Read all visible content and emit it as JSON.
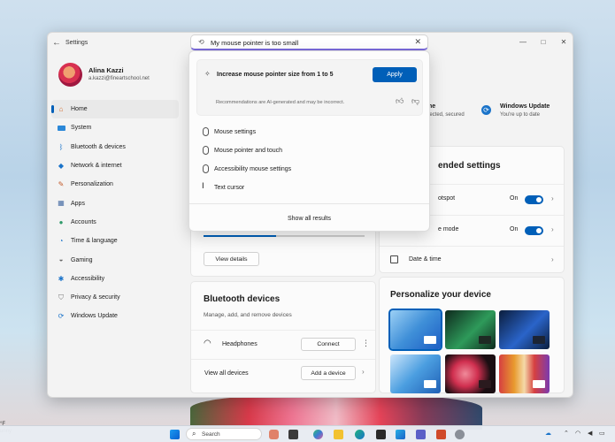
{
  "window": {
    "title": "Settings",
    "controls": [
      "—",
      "□",
      "✕"
    ]
  },
  "profile": {
    "name": "Alina Kazzi",
    "email": "a.kazzi@fineartschool.net"
  },
  "sidebar": {
    "items": [
      {
        "label": "Home",
        "icon": "home-icon",
        "active": true
      },
      {
        "label": "System",
        "icon": "system-icon"
      },
      {
        "label": "Bluetooth & devices",
        "icon": "bluetooth-icon"
      },
      {
        "label": "Network & internet",
        "icon": "wifi-icon"
      },
      {
        "label": "Personalization",
        "icon": "brush-icon"
      },
      {
        "label": "Apps",
        "icon": "apps-icon"
      },
      {
        "label": "Accounts",
        "icon": "accounts-icon"
      },
      {
        "label": "Time & language",
        "icon": "globe-clock-icon"
      },
      {
        "label": "Gaming",
        "icon": "gamepad-icon"
      },
      {
        "label": "Accessibility",
        "icon": "accessibility-icon"
      },
      {
        "label": "Privacy & security",
        "icon": "shield-icon"
      },
      {
        "label": "Windows Update",
        "icon": "update-icon"
      }
    ]
  },
  "search": {
    "value": "My mouse pointer is too small",
    "clear": "✕"
  },
  "popup": {
    "ai_suggestion": "Increase mouse pointer size from 1 to 5",
    "apply_label": "Apply",
    "ai_note": "Recommendations are AI-generated and may be incorrect.",
    "results": [
      {
        "label": "Mouse settings",
        "icon": "mouse-icon"
      },
      {
        "label": "Mouse pointer and touch",
        "icon": "mouse-icon"
      },
      {
        "label": "Accessibility mouse settings",
        "icon": "mouse-icon"
      },
      {
        "label": "Text cursor",
        "icon": "text-cursor-icon"
      }
    ],
    "show_all": "Show all results"
  },
  "status": {
    "partial_label_1": "me",
    "partial_sub_1": "nected, secured",
    "update_title": "Windows Update",
    "update_sub": "You're up to date"
  },
  "recommended": {
    "title_partial": "ended settings",
    "rows": [
      {
        "label_partial": "otspot",
        "state": "On",
        "toggle": true
      },
      {
        "label_partial": "e mode",
        "state": "On",
        "toggle": true
      },
      {
        "label": "Date & time",
        "icon": "calendar-icon"
      }
    ]
  },
  "storage": {
    "view_details": "View details"
  },
  "bluetooth": {
    "title": "Bluetooth devices",
    "subtitle": "Manage, add, and remove devices",
    "device": "Headphones",
    "connect_label": "Connect",
    "more": "⋮",
    "view_all": "View all devices",
    "add_device": "Add a device"
  },
  "personalize": {
    "title": "Personalize your device",
    "themes": [
      {
        "bg": "#3f8fd8",
        "accent": "#1d5ec4",
        "selected": true
      },
      {
        "bg": "#0e2a1d",
        "accent": "#2e9a5a"
      },
      {
        "bg": "#0b1d3c",
        "accent": "#2a64c9"
      },
      {
        "bg": "#4b9ee0",
        "accent": "#1f5fb5"
      },
      {
        "bg": "#1a0e12",
        "accent": "#d02f4f"
      },
      {
        "bg": "#d64040",
        "accent": "#e89a2e"
      }
    ]
  },
  "taskbar": {
    "search_label": "Search",
    "desktop_label": "unny"
  },
  "colors": {
    "accent": "#005fb8",
    "search_underline": "#7a6adb"
  }
}
